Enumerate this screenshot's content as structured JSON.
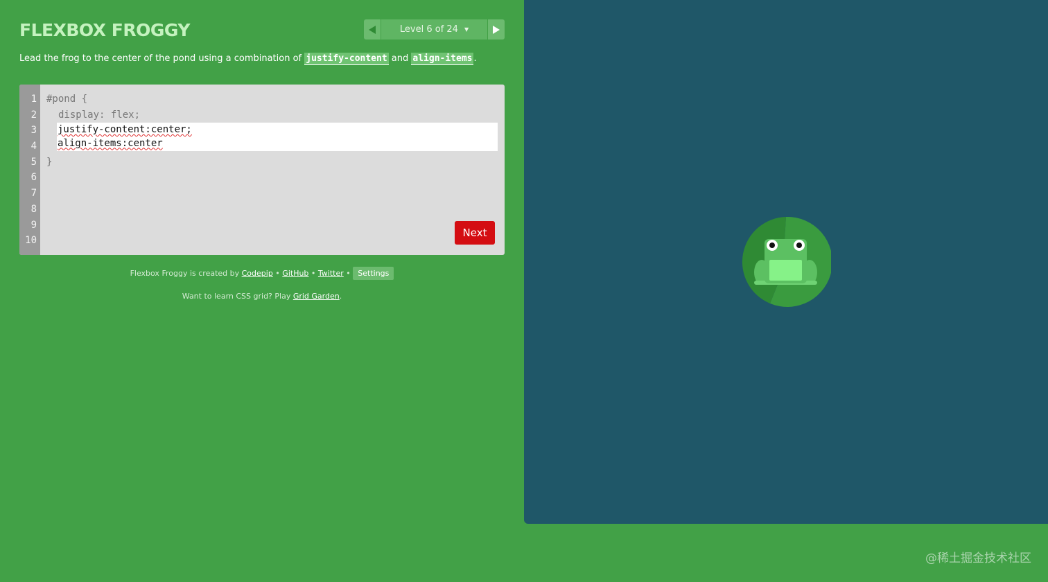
{
  "header": {
    "title": "FLEXBOX FROGGY"
  },
  "level_nav": {
    "label": "Level 6 of 24",
    "prev_icon": "triangle-left-icon",
    "next_icon": "triangle-right-icon",
    "caret": "▼"
  },
  "instructions": {
    "prefix": "Lead the frog to the center of the pond using a combination of ",
    "keyword_1": "justify-content",
    "middle": " and ",
    "keyword_2": "align-items",
    "suffix": "."
  },
  "editor": {
    "line_numbers": [
      "1",
      "2",
      "3",
      "4",
      "5",
      "6",
      "7",
      "8",
      "9",
      "10"
    ],
    "line_1": "#pond {",
    "line_2": "display: flex;",
    "line_5": "}",
    "input_lines": [
      "justify-content:center;",
      "align-items:center"
    ],
    "next_label": "Next"
  },
  "footer": {
    "credits_prefix": "Flexbox Froggy is created by ",
    "codepip": "Codepip",
    "sep": " • ",
    "github": "GitHub",
    "twitter": "Twitter",
    "settings": "Settings",
    "grid_prefix": "Want to learn CSS grid? Play ",
    "grid_link": "Grid Garden",
    "grid_suffix": "."
  },
  "pond": {
    "frog_color": "green",
    "icon": "frog-on-lilypad-icon"
  },
  "watermark": "@稀土掘金技术社区",
  "colors": {
    "background": "#42a147",
    "pond": "#1f5768",
    "next_button": "#d40d12",
    "title": "#c5f2bf"
  }
}
